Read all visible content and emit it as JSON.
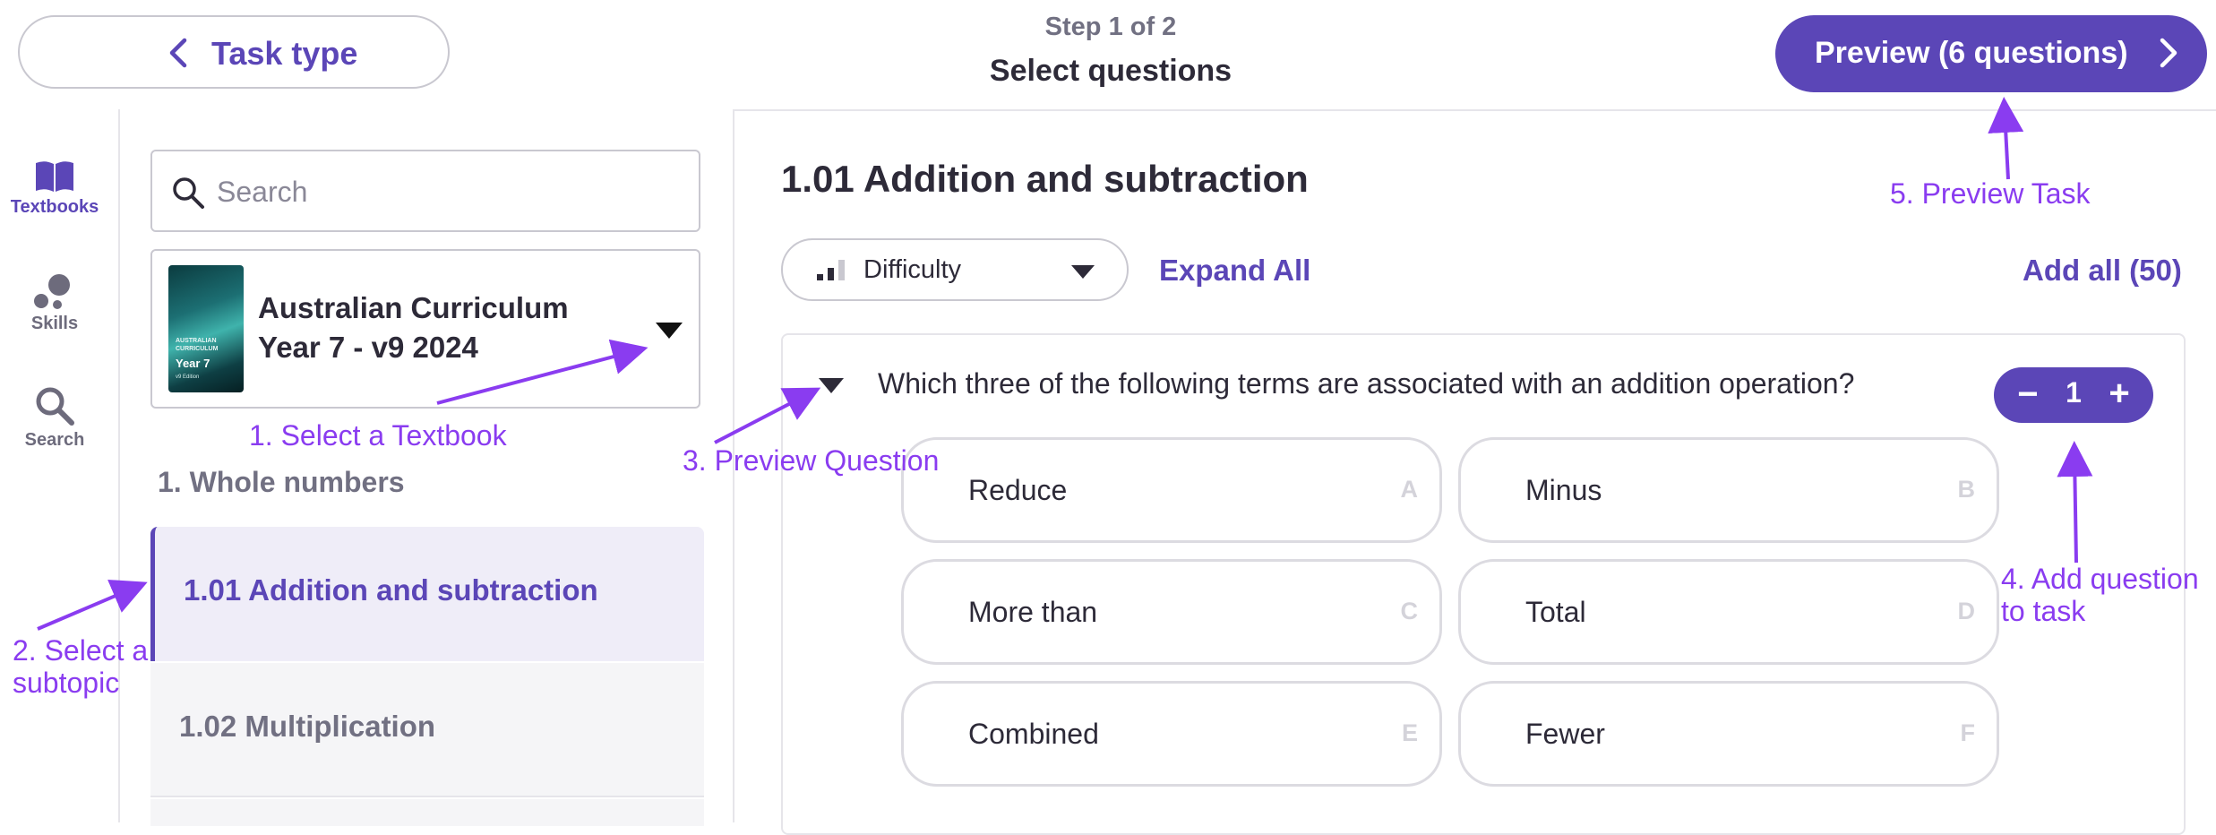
{
  "header": {
    "back_label": "Task type",
    "step_text": "Step 1 of 2",
    "step_title": "Select questions",
    "preview_label": "Preview (6 questions)"
  },
  "rail": {
    "items": [
      {
        "label": "Textbooks",
        "icon": "book-icon",
        "active": true
      },
      {
        "label": "Skills",
        "icon": "skills-icon",
        "active": false
      },
      {
        "label": "Search",
        "icon": "search-icon",
        "active": false
      }
    ]
  },
  "sidebar": {
    "search_placeholder": "Search",
    "textbook": {
      "title": "Australian Curriculum Year 7 - v9 2024",
      "cover_line1": "AUSTRALIAN CURRICULUM",
      "cover_year": "Year 7",
      "cover_edition": "v9 Edition"
    },
    "chapter": "1. Whole numbers",
    "subtopics": [
      {
        "label": "1.01 Addition and subtraction",
        "active": true
      },
      {
        "label": "1.02 Multiplication",
        "active": false
      }
    ]
  },
  "main": {
    "title": "1.01 Addition and subtraction",
    "difficulty_label": "Difficulty",
    "expand_all": "Expand All",
    "add_all": "Add all (50)",
    "question": {
      "text": "Which three of the following terms are associated with an addition operation?",
      "count": "1",
      "options": [
        {
          "text": "Reduce",
          "letter": "A"
        },
        {
          "text": "Minus",
          "letter": "B"
        },
        {
          "text": "More than",
          "letter": "C"
        },
        {
          "text": "Total",
          "letter": "D"
        },
        {
          "text": "Combined",
          "letter": "E"
        },
        {
          "text": "Fewer",
          "letter": "F"
        }
      ]
    }
  },
  "annotations": {
    "a1": "1. Select a Textbook",
    "a2_line1": "2. Select a",
    "a2_line2": "subtopic",
    "a3": "3. Preview Question",
    "a4_line1": "4. Add question",
    "a4_line2": "to task",
    "a5": "5. Preview Task"
  },
  "colors": {
    "accent": "#5b46b7",
    "annotation": "#8a3cf0",
    "active_bg": "#efedf8"
  }
}
